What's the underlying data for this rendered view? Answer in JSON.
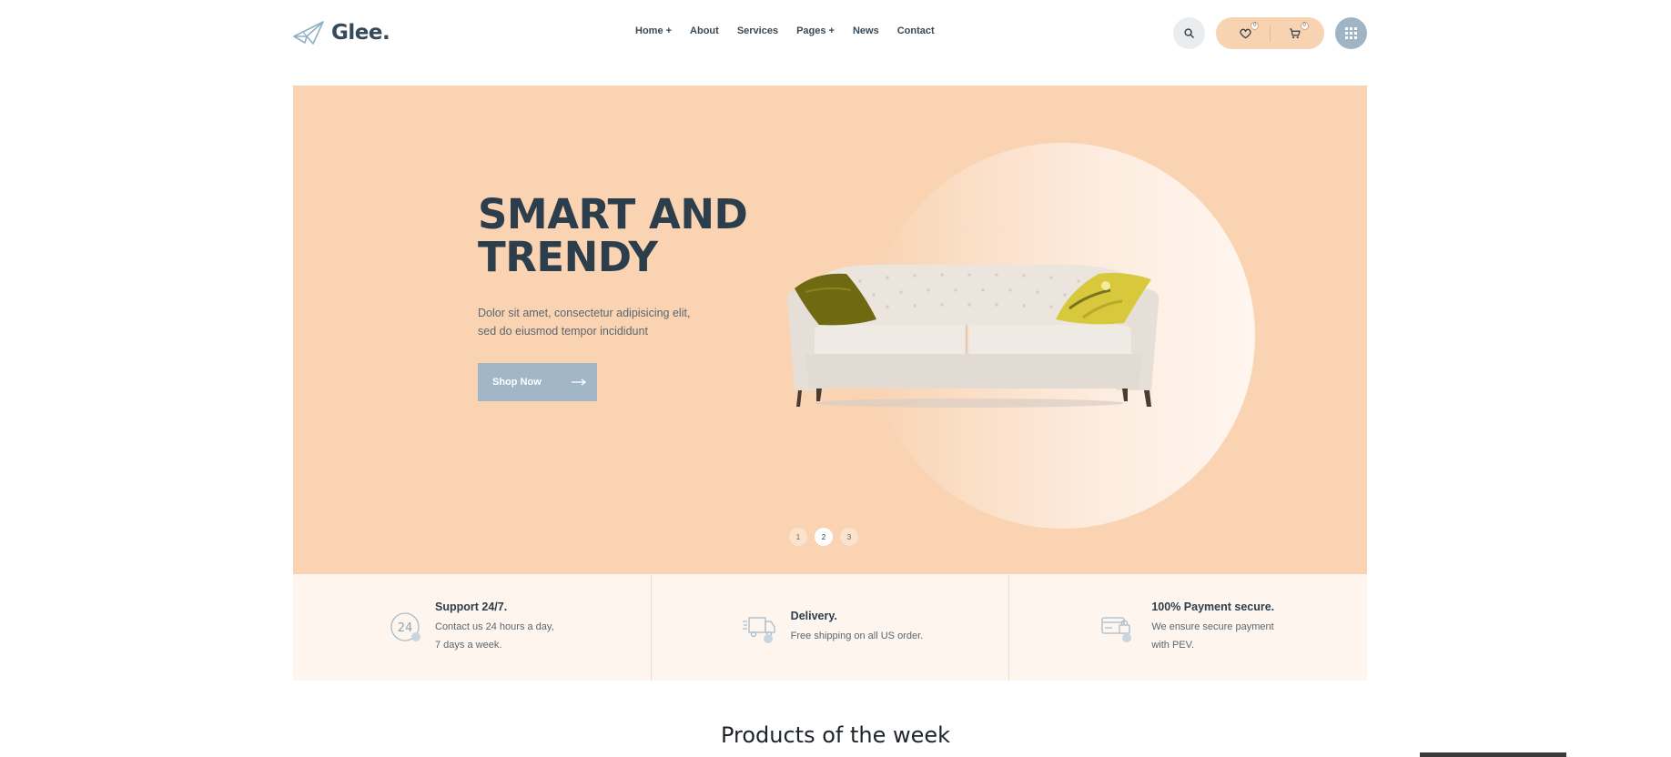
{
  "brand": {
    "name": "Glee."
  },
  "nav": {
    "items": [
      {
        "label": "Home +"
      },
      {
        "label": "About"
      },
      {
        "label": "Services"
      },
      {
        "label": "Pages +"
      },
      {
        "label": "News"
      },
      {
        "label": "Contact"
      }
    ]
  },
  "header_actions": {
    "search_icon": "search-icon",
    "wishlist_count": "0",
    "cart_count": "0",
    "menu_icon": "grid-menu-icon"
  },
  "hero": {
    "title_line1": "SMART AND",
    "title_line2": "TRENDY",
    "desc_line1": "Dolor sit amet, consectetur adipisicing elit,",
    "desc_line2": "sed do eiusmod tempor incididunt",
    "cta_label": "Shop Now",
    "slides": [
      "1",
      "2",
      "3"
    ],
    "active_slide": "2"
  },
  "features": [
    {
      "icon": "support-24-icon",
      "title": "Support 24/7.",
      "line1": "Contact us 24 hours a day,",
      "line2": "7 days a week."
    },
    {
      "icon": "delivery-truck-icon",
      "title": "Delivery.",
      "line1": "Free shipping on all US order.",
      "line2": ""
    },
    {
      "icon": "secure-payment-icon",
      "title": "100% Payment secure.",
      "line1": "We ensure secure payment",
      "line2": "with PEV."
    }
  ],
  "products_section": {
    "title": "Products of the week"
  },
  "colors": {
    "accent_peach": "#f9d3b2",
    "button_blue": "#a1b7c7",
    "text_dark": "#2c3d4c",
    "features_bg": "#fdf5ee"
  }
}
